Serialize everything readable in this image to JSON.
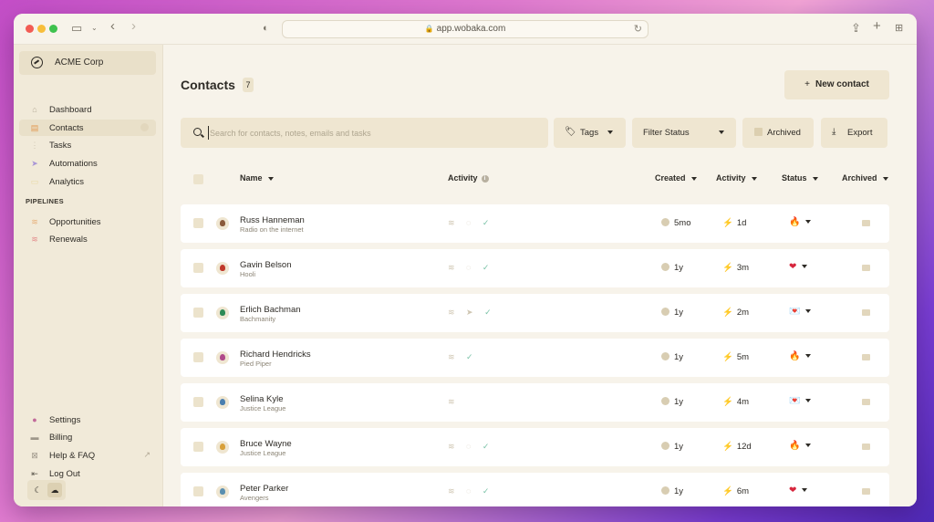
{
  "browser": {
    "url": "app.wobaka.com"
  },
  "sidebar": {
    "org_name": "ACME Corp",
    "nav": [
      {
        "label": "Dashboard",
        "icon": "home-icon"
      },
      {
        "label": "Contacts",
        "icon": "contacts-icon",
        "active": true
      },
      {
        "label": "Tasks",
        "icon": "tasks-icon"
      },
      {
        "label": "Automations",
        "icon": "automations-icon"
      },
      {
        "label": "Analytics",
        "icon": "analytics-icon"
      }
    ],
    "pipelines_title": "PIPELINES",
    "pipelines": [
      {
        "label": "Opportunities",
        "icon": "stack-icon"
      },
      {
        "label": "Renewals",
        "icon": "stack-icon"
      }
    ],
    "bottom": [
      {
        "label": "Settings",
        "icon": "settings-icon"
      },
      {
        "label": "Billing",
        "icon": "billing-icon"
      },
      {
        "label": "Help & FAQ",
        "icon": "help-icon"
      },
      {
        "label": "Log Out",
        "icon": "logout-icon"
      }
    ]
  },
  "main": {
    "title": "Contacts",
    "count": "7",
    "new_contact": "New contact",
    "search_placeholder": "Search for contacts, notes, emails and tasks",
    "filters": {
      "tags": "Tags",
      "filter_status": "Filter Status",
      "archived": "Archived",
      "export": "Export"
    },
    "columns": {
      "name": "Name",
      "activity_icons": "Activity",
      "created": "Created",
      "activity": "Activity",
      "status": "Status",
      "archived": "Archived"
    }
  },
  "rows": [
    {
      "name": "Russ Hanneman",
      "sub": "Radio on the internet",
      "acts": "≋ ◌ ✓",
      "created": "5mo",
      "activity": "1d",
      "status": "🔥",
      "avatar_color": "#8a5a3b"
    },
    {
      "name": "Gavin Belson",
      "sub": "Hooli",
      "acts": "≋ ◌ ✓",
      "created": "1y",
      "activity": "3m",
      "status": "❤",
      "avatar_color": "#c0392b"
    },
    {
      "name": "Erlich Bachman",
      "sub": "Bachmanity",
      "acts": "≋ ➤ ✓",
      "created": "1y",
      "activity": "2m",
      "status": "💌",
      "avatar_color": "#2e8b57"
    },
    {
      "name": "Richard Hendricks",
      "sub": "Pied Piper",
      "acts": "≋ ✓",
      "created": "1y",
      "activity": "5m",
      "status": "🔥",
      "avatar_color": "#b04a8a"
    },
    {
      "name": "Selina Kyle",
      "sub": "Justice League",
      "acts": "≋",
      "created": "1y",
      "activity": "4m",
      "status": "💌",
      "avatar_color": "#4a7fb0"
    },
    {
      "name": "Bruce Wayne",
      "sub": "Justice League",
      "acts": "≋ ◌ ✓",
      "created": "1y",
      "activity": "12d",
      "status": "🔥",
      "avatar_color": "#d8a03a"
    },
    {
      "name": "Peter Parker",
      "sub": "Avengers",
      "acts": "≋ ◌ ✓",
      "created": "1y",
      "activity": "6m",
      "status": "❤",
      "avatar_color": "#5a8fb0"
    }
  ]
}
